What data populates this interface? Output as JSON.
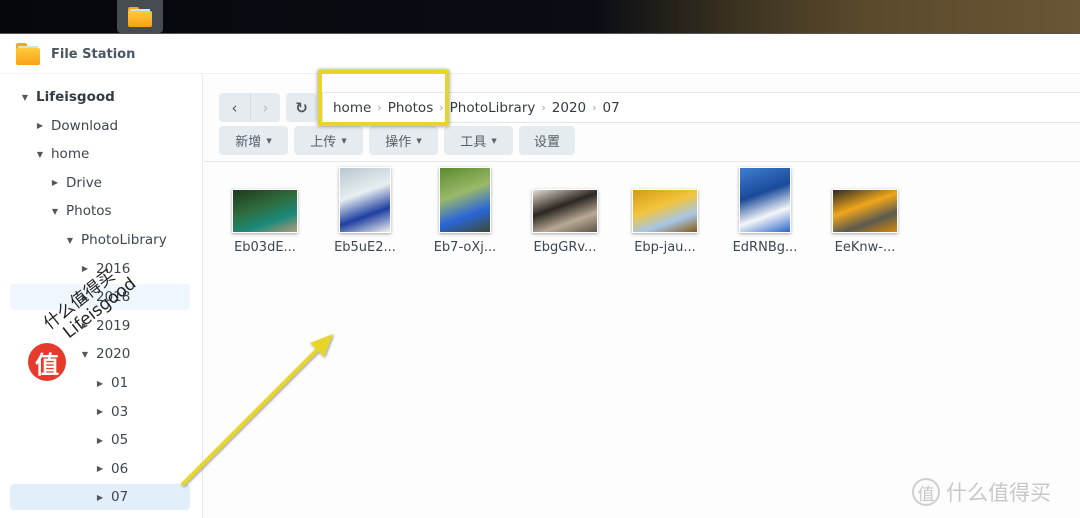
{
  "taskbar": {
    "main_menu_icon": "grid-icon",
    "apps": [
      {
        "name": "File Station",
        "icon": "folder-icon",
        "active": true
      }
    ]
  },
  "window": {
    "title": "File Station",
    "icon": "folder-icon"
  },
  "sidebar": {
    "tree": [
      {
        "label": "Lifeisgood",
        "level": 0,
        "state": "expanded",
        "root": true
      },
      {
        "label": "Download",
        "level": 1,
        "state": "collapsed"
      },
      {
        "label": "home",
        "level": 1,
        "state": "expanded"
      },
      {
        "label": "Drive",
        "level": 2,
        "state": "collapsed"
      },
      {
        "label": "Photos",
        "level": 2,
        "state": "expanded"
      },
      {
        "label": "PhotoLibrary",
        "level": 3,
        "state": "expanded"
      },
      {
        "label": "2016",
        "level": 4,
        "state": "collapsed"
      },
      {
        "label": "2018",
        "level": 4,
        "state": "collapsed",
        "hover": true
      },
      {
        "label": "2019",
        "level": 4,
        "state": "collapsed"
      },
      {
        "label": "2020",
        "level": 4,
        "state": "expanded"
      },
      {
        "label": "01",
        "level": 5,
        "state": "collapsed"
      },
      {
        "label": "03",
        "level": 5,
        "state": "collapsed"
      },
      {
        "label": "05",
        "level": 5,
        "state": "collapsed"
      },
      {
        "label": "06",
        "level": 5,
        "state": "collapsed"
      },
      {
        "label": "07",
        "level": 5,
        "state": "collapsed",
        "selected": true
      }
    ]
  },
  "nav": {
    "back_icon": "‹",
    "forward_icon": "›",
    "refresh_icon": "↻"
  },
  "breadcrumb": [
    "home",
    "Photos",
    "PhotoLibrary",
    "2020",
    "07"
  ],
  "breadcrumb_separator": "›",
  "toolbar": {
    "buttons": [
      {
        "label": "新增",
        "dropdown": true
      },
      {
        "label": "上传",
        "dropdown": true
      },
      {
        "label": "操作",
        "dropdown": true
      },
      {
        "label": "工具",
        "dropdown": true
      },
      {
        "label": "设置",
        "dropdown": false
      }
    ],
    "caret": "▼"
  },
  "files": [
    {
      "name": "Eb03dE...",
      "orientation": "landscape",
      "colors": [
        "#1d3a1a",
        "#2f6b3c",
        "#1a8a7a",
        "#b39a78"
      ]
    },
    {
      "name": "Eb5uE2...",
      "orientation": "portrait",
      "colors": [
        "#b8c8cf",
        "#e8eef0",
        "#1e3fa0",
        "#f2f2f2"
      ]
    },
    {
      "name": "Eb7-oXj...",
      "orientation": "portrait",
      "colors": [
        "#5b8a2e",
        "#9ab96a",
        "#2a66d8",
        "#3a4a30"
      ]
    },
    {
      "name": "EbgGRv...",
      "orientation": "landscape",
      "colors": [
        "#e7ddd0",
        "#2a2622",
        "#b8a994",
        "#5b5346"
      ]
    },
    {
      "name": "Ebp-jau...",
      "orientation": "landscape",
      "colors": [
        "#d59a14",
        "#f2c53d",
        "#a6c6e6",
        "#8a5a10"
      ]
    },
    {
      "name": "EdRNBg...",
      "orientation": "portrait",
      "colors": [
        "#3f7fd0",
        "#1a4a9a",
        "#f4f6f8",
        "#2a64c8"
      ]
    },
    {
      "name": "EeKnw-...",
      "orientation": "landscape",
      "colors": [
        "#2a2a26",
        "#f0a61a",
        "#5a5a50",
        "#d88a0a"
      ]
    }
  ],
  "annotations": {
    "highlight_box_color": "#e7d52a",
    "arrow_color": "#e7d52a"
  },
  "watermarks": {
    "badge_char": "值",
    "line1": "什么值得买",
    "line2": "Lifeisgood",
    "corner_circle": "值",
    "corner_text": "什么值得买"
  }
}
